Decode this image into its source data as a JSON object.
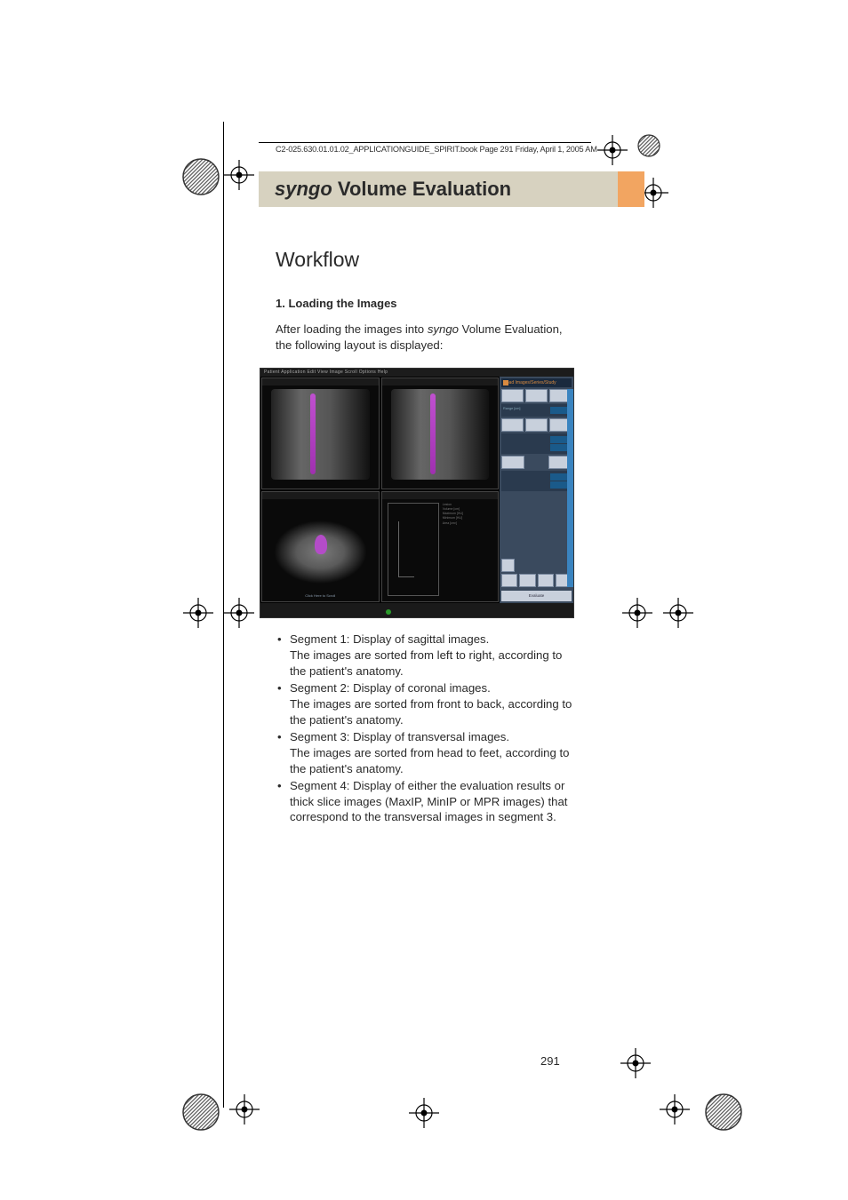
{
  "header_tagline": "C2-025.630.01.01.02_APPLICATIONGUIDE_SPIRIT.book  Page 291  Friday, April 1, 2005       AM",
  "title": {
    "italic": "syngo",
    "rest": " Volume Evaluation"
  },
  "section": "Workflow",
  "subheading": "1. Loading the Images",
  "intro": {
    "pre": "After loading the images into ",
    "ital": "syngo",
    "post": " Volume Evaluation, the following layout is displayed:"
  },
  "screenshot": {
    "menubar": "Patient  Application  Edit  View  Image  Scroll  Options  Help",
    "pane_caption": "Click Here to Scroll",
    "right_title": "Load Images/Series/Study",
    "range_label": "Range [cm]",
    "eval_btn": "Evaluate"
  },
  "bullets": [
    {
      "head": "Segment 1: Display of sagittal images.",
      "body": "The images are sorted from left to right, according to the patient's anatomy."
    },
    {
      "head": "Segment 2: Display of coronal images.",
      "body": "The images are sorted from front to back, according to the patient's anatomy."
    },
    {
      "head": "Segment 3: Display of transversal images.",
      "body": "The images are sorted from head to feet, according to the patient's anatomy."
    },
    {
      "head": "Segment 4: Display of either the evaluation results or thick slice images (MaxIP, MinIP or MPR images) that correspond to the transversal images in segment 3.",
      "body": ""
    }
  ],
  "page_number": "291"
}
